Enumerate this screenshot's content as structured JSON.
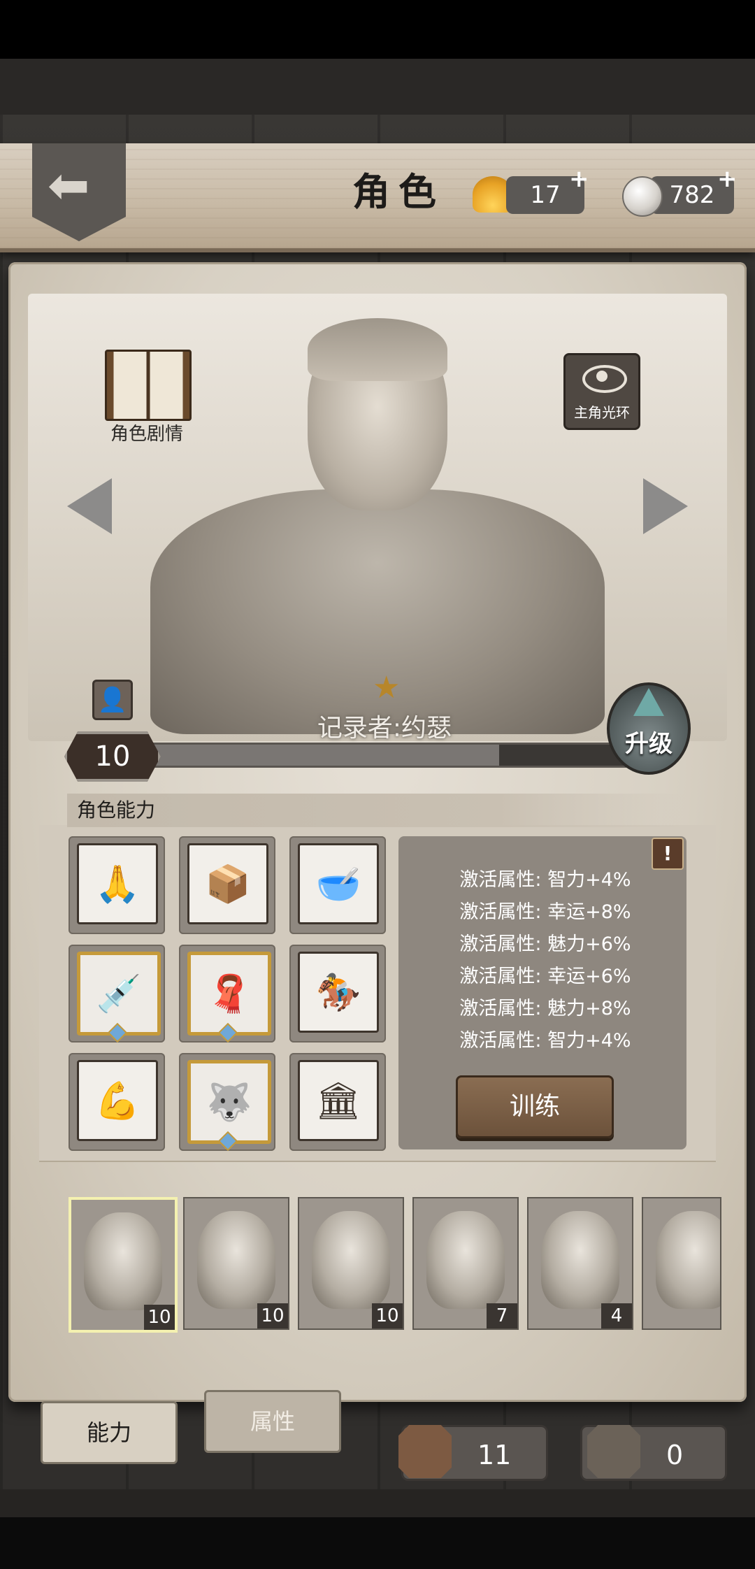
{
  "header": {
    "title": "角色",
    "back_icon": "back-arrow-icon",
    "shells": {
      "value": "17",
      "plus": "+",
      "icon": "shell-icon"
    },
    "coins": {
      "value": "782",
      "plus": "+",
      "icon": "coin-icon"
    }
  },
  "portrait": {
    "story_label": "角色剧情",
    "aura_label": "主角光环",
    "character_name": "记录者:约瑟",
    "star": "★",
    "level": "10",
    "level_progress": 0.73,
    "upgrade_label": "升级"
  },
  "abilities": {
    "section_title": "角色能力",
    "alert": "!",
    "grid": [
      {
        "name": "praying-hands-icon",
        "glyph": "🙏",
        "gold": false
      },
      {
        "name": "carry-box-icon",
        "glyph": "📦",
        "gold": false
      },
      {
        "name": "bowl-icon",
        "glyph": "🥣",
        "gold": false
      },
      {
        "name": "syringe-icon",
        "glyph": "💉",
        "gold": true
      },
      {
        "name": "scarf-icon",
        "glyph": "🧣",
        "gold": true
      },
      {
        "name": "rider-icon",
        "glyph": "🏇",
        "gold": false
      },
      {
        "name": "muscle-icon",
        "glyph": "💪",
        "gold": false
      },
      {
        "name": "wolf-icon",
        "glyph": "🐺",
        "gold": true
      },
      {
        "name": "bank-icon",
        "glyph": "🏛",
        "gold": false
      }
    ],
    "attributes": [
      "激活属性: 智力+4%",
      "激活属性: 幸运+8%",
      "激活属性: 魅力+6%",
      "激活属性: 幸运+6%",
      "激活属性: 魅力+8%",
      "激活属性: 智力+4%"
    ],
    "train_label": "训练"
  },
  "characters": [
    {
      "level": "10",
      "selected": true
    },
    {
      "level": "10",
      "selected": false
    },
    {
      "level": "10",
      "selected": false
    },
    {
      "level": "7",
      "selected": false
    },
    {
      "level": "4",
      "selected": false
    },
    {
      "level": "",
      "selected": false
    }
  ],
  "tabs": {
    "ability": "能力",
    "attribute": "属性"
  },
  "counters": {
    "fragments": "11",
    "character_fragments": "0"
  },
  "colors": {
    "accent_gold": "#c59a3a",
    "panel_gray": "#8e877f",
    "train_brown": "#7a5f46"
  }
}
